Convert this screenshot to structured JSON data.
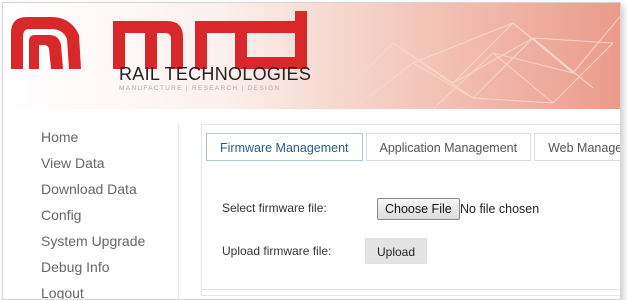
{
  "header": {
    "logo_text": "mrd",
    "company": "RAIL TECHNOLOGIES",
    "tagline": "MANUFACTURE  |  RESEARCH  |  DESIGN"
  },
  "sidebar": {
    "items": [
      {
        "label": "Home"
      },
      {
        "label": "View Data"
      },
      {
        "label": "Download Data"
      },
      {
        "label": "Config"
      },
      {
        "label": "System Upgrade"
      },
      {
        "label": "Debug Info"
      },
      {
        "label": "Logout"
      }
    ]
  },
  "tabs": [
    {
      "label": "Firmware Management",
      "active": true
    },
    {
      "label": "Application Management"
    },
    {
      "label": "Web Management"
    }
  ],
  "form": {
    "select_label": "Select firmware file:",
    "choose_button": "Choose File",
    "file_status": "No file chosen",
    "upload_label": "Upload firmware file:",
    "upload_button": "Upload"
  },
  "colors": {
    "brand_red": "#d8282c",
    "active_tab_text": "#2a5d8e"
  }
}
